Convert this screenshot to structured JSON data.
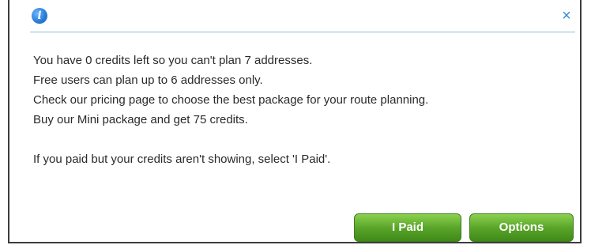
{
  "dialog": {
    "icon": "info-icon",
    "close_glyph": "×",
    "lines": [
      "You have 0 credits left so you can't plan 7 addresses.",
      "Free users can plan up to 6 addresses only.",
      "Check our pricing page to choose the best package for your route planning.",
      "Buy our Mini package and get 75 credits."
    ],
    "note": "If you paid but your credits aren't showing, select 'I Paid'.",
    "buttons": {
      "paid_label": "I Paid",
      "options_label": "Options"
    }
  },
  "colors": {
    "accent": "#3a8bd0",
    "button_green": "#5aa52a"
  }
}
